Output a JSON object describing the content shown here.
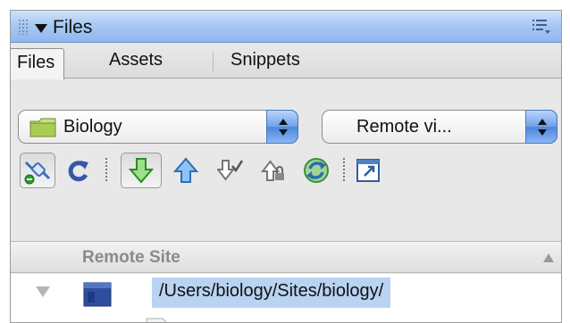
{
  "panel": {
    "title": "Files",
    "tabs": [
      "Files",
      "Assets",
      "Snippets"
    ],
    "active_tab": "Files"
  },
  "site_select": {
    "value": "Biology"
  },
  "view_select": {
    "value": "Remote vi..."
  },
  "toolbar": {
    "icons": [
      "connect-icon",
      "refresh-icon",
      "get-files-icon",
      "put-files-icon",
      "check-out-icon",
      "check-in-icon",
      "synchronize-icon",
      "expand-icon"
    ],
    "pressed": "get-files-icon"
  },
  "column": {
    "header": "Remote Site"
  },
  "files": [
    {
      "label": "/Users/biology/Sites/biology/",
      "selected": true
    }
  ],
  "colors": {
    "title_bar": "#a9c9f3",
    "selection": "#b9d3f2",
    "stepper": "#6fa1ea"
  }
}
